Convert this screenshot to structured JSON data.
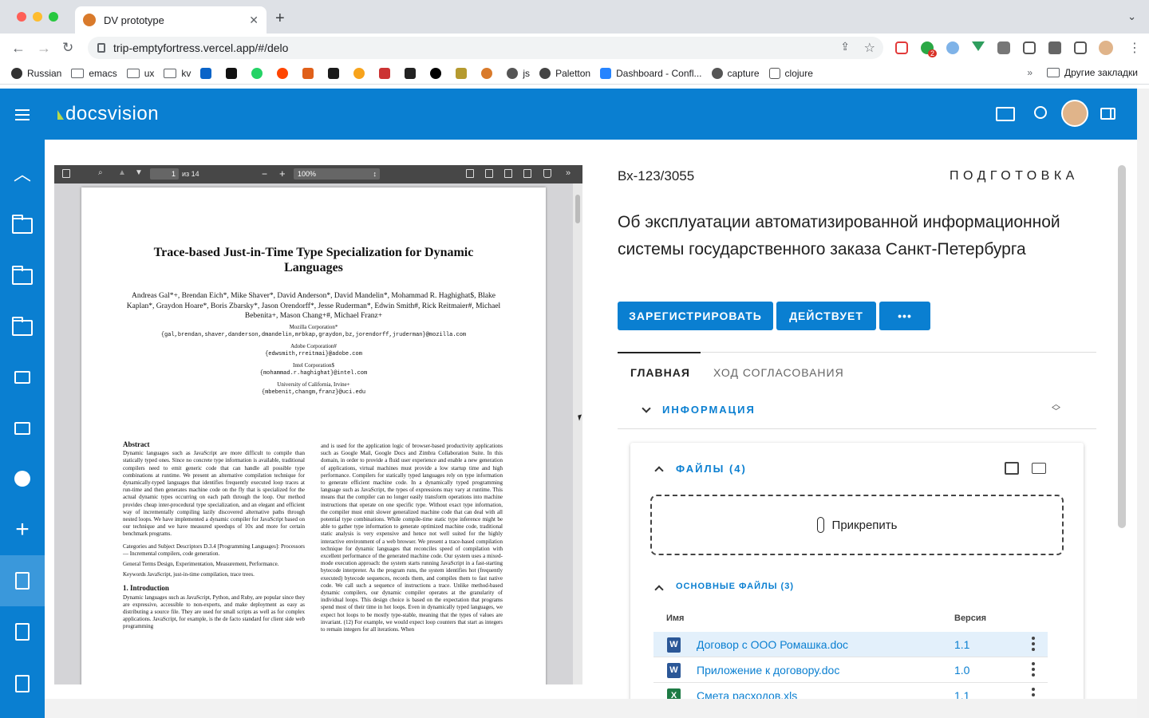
{
  "browser": {
    "tab_title": "DV prototype",
    "url": "trip-emptyfortress.vercel.app/#/delo",
    "bookmarks": [
      "Russian",
      "emacs",
      "ux",
      "kv",
      "js",
      "Paletton",
      "Dashboard - Confl...",
      "capture",
      "clojure"
    ],
    "other_bookmarks": "Другие закладки",
    "ext_badge": "2"
  },
  "app": {
    "logo": "docsvision"
  },
  "pdf": {
    "page_number": "1",
    "page_of": "из 14",
    "zoom": "100%",
    "title": "Trace-based Just-in-Time Type Specialization for Dynamic Languages",
    "authors": "Andreas Gal*+, Brendan Eich*, Mike Shaver*, David Anderson*, David Mandelin*, Mohammad R. Haghighat$, Blake Kaplan*, Graydon Hoare*, Boris Zbarsky*, Jason Orendorff*, Jesse Ruderman*, Edwin Smith#, Rick Reitmaier#, Michael Bebenita+, Mason Chang+#, Michael Franz+",
    "aff1": "Mozilla Corporation*",
    "aff1_mail": "{gal,brendan,shaver,danderson,dmandelin,mrbkap,graydon,bz,jorendorff,jruderman}@mozilla.com",
    "aff2": "Adobe Corporation#",
    "aff2_mail": "{edwsmith,rreitmai}@adobe.com",
    "aff3": "Intel Corporation$",
    "aff3_mail": "{mohammad.r.haghighat}@intel.com",
    "aff4": "University of California, Irvine+",
    "aff4_mail": "{mbebenit,changm,franz}@uci.edu",
    "abstract_heading": "Abstract",
    "abstract_text": "Dynamic languages such as JavaScript are more difficult to compile than statically typed ones. Since no concrete type information is available, traditional compilers need to emit generic code that can handle all possible type combinations at runtime. We present an alternative compilation technique for dynamically-typed languages that identifies frequently executed loop traces at run-time and then generates machine code on the fly that is specialized for the actual dynamic types occurring on each path through the loop. Our method provides cheap inter-procedural type specialization, and an elegant and efficient way of incrementally compiling lazily discovered alternative paths through nested loops. We have implemented a dynamic compiler for JavaScript based on our technique and we have measured speedups of 10x and more for certain benchmark programs.",
    "categories": "Categories and Subject Descriptors D.3.4 [Programming Languages]: Processors — Incremental compilers, code generation.",
    "terms": "General Terms Design, Experimentation, Measurement, Performance.",
    "keywords": "Keywords JavaScript, just-in-time compilation, trace trees.",
    "intro_heading": "1. Introduction",
    "intro_text": "Dynamic languages such as JavaScript, Python, and Ruby, are popular since they are expressive, accessible to non-experts, and make deployment as easy as distributing a source file. They are used for small scripts as well as for complex applications. JavaScript, for example, is the de facto standard for client side web programming",
    "right_col": "and is used for the application logic of browser-based productivity applications such as Google Mail, Google Docs and Zimbra Collaboration Suite. In this domain, in order to provide a fluid user experience and enable a new generation of applications, virtual machines must provide a low startup time and high performance. Compilers for statically typed languages rely on type information to generate efficient machine code. In a dynamically typed programming language such as JavaScript, the types of expressions may vary at runtime. This means that the compiler can no longer easily transform operations into machine instructions that operate on one specific type. Without exact type information, the compiler must emit slower generalized machine code that can deal with all potential type combinations. While compile-time static type inference might be able to gather type information to generate optimized machine code, traditional static analysis is very expensive and hence not well suited for the highly interactive environment of a web browser. We present a trace-based compilation technique for dynamic languages that reconciles speed of compilation with excellent performance of the generated machine code. Our system uses a mixed-mode execution approach: the system starts running JavaScript in a fast-starting bytecode interpreter. As the program runs, the system identifies hot (frequently executed) bytecode sequences, records them, and compiles them to fast native code. We call such a sequence of instructions a trace. Unlike method-based dynamic compilers, our dynamic compiler operates at the granularity of individual loops. This design choice is based on the expectation that programs spend most of their time in hot loops. Even in dynamically typed languages, we expect hot loops to be mostly type-stable, meaning that the types of values are invariant. (12) For example, we would expect loop counters that start as integers to remain integers for all iterations. When"
  },
  "document": {
    "number": "Вх-123/3055",
    "state": "ПОДГОТОВКА",
    "title": "Об эксплуатации автоматизированной информационной системы государственного заказа Санкт-Петербурга",
    "buttons": {
      "register": "ЗАРЕГИСТРИРОВАТЬ",
      "active": "ДЕЙСТВУЕТ",
      "more": "•••"
    },
    "tabs": {
      "main": "ГЛАВНАЯ",
      "history": "ХОД СОГЛАСОВАНИЯ"
    },
    "info_label": "ИНФОРМАЦИЯ",
    "files_label": "ФАЙЛЫ (4)",
    "attach_label": "Прикрепить",
    "main_files_label": "ОСНОВНЫЕ ФАЙЛЫ (3)",
    "columns": {
      "name": "Имя",
      "version": "Версия"
    },
    "files": [
      {
        "icon": "W",
        "name": "Договор с ООО Ромашка.doc",
        "version": "1.1"
      },
      {
        "icon": "W",
        "name": "Приложение к договору.doc",
        "version": "1.0"
      },
      {
        "icon": "X",
        "name": "Смета расходов.xls",
        "version": "1.1"
      }
    ]
  },
  "colors": {
    "accent": "#0a7fd1",
    "selected_row": "#e3f0fb"
  }
}
